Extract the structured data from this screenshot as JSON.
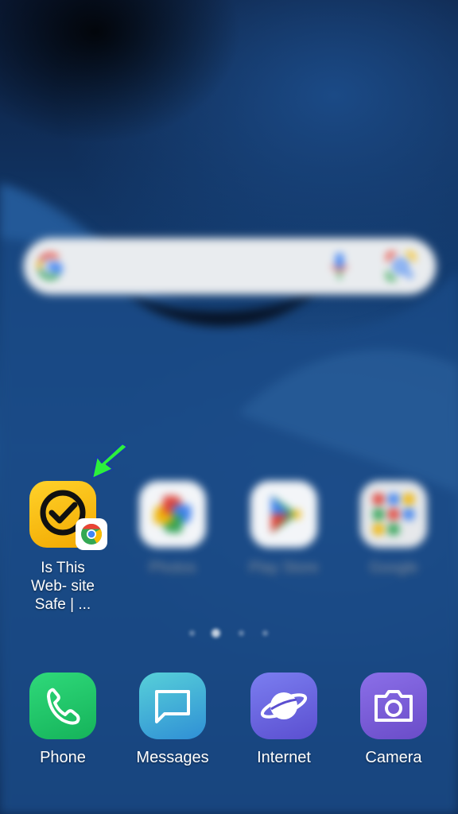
{
  "search_bar": {
    "icons": [
      "google-g-icon",
      "microphone-icon",
      "google-lens-icon"
    ]
  },
  "featured_app": {
    "label": "Is This Web- site Safe | ...",
    "icon": "yellow-checkmark-icon",
    "badge": "chrome-icon",
    "pointer": "green-arrow-icon"
  },
  "home_apps": [
    {
      "label": "Photos",
      "icon": "google-photos-icon"
    },
    {
      "label": "Play Store",
      "icon": "play-store-icon"
    },
    {
      "label": "Google",
      "icon": "google-folder-icon"
    }
  ],
  "page_indicator": {
    "pages": 4,
    "current": 2
  },
  "dock": [
    {
      "label": "Phone",
      "icon": "phone-icon",
      "color": "#1fc66b"
    },
    {
      "label": "Messages",
      "icon": "messages-icon",
      "color": "#3fb9d6"
    },
    {
      "label": "Internet",
      "icon": "internet-planet-icon",
      "color": "#6c6fe0"
    },
    {
      "label": "Camera",
      "icon": "camera-icon",
      "color": "#7a5fd6"
    }
  ],
  "colors": {
    "featured_icon_bg": "#f7b400",
    "arrow": "#2cf03c"
  }
}
